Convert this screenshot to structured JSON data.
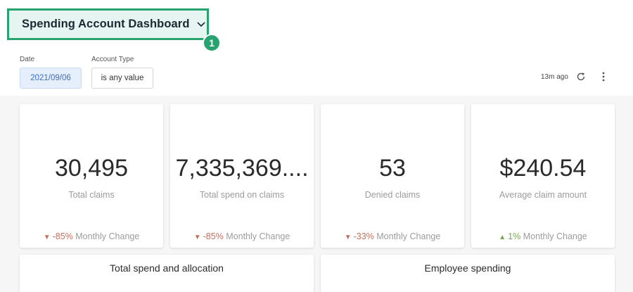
{
  "header": {
    "title": "Spending Account Dashboard",
    "step_badge": "1",
    "accent_color": "#27a36f"
  },
  "filters": [
    {
      "label": "Date",
      "value": "2021/09/06"
    },
    {
      "label": "Account Type",
      "value": "is any value"
    }
  ],
  "toolbar": {
    "updated": "13m ago",
    "icons": [
      "refresh-icon",
      "more-vert-icon"
    ]
  },
  "kpis": [
    {
      "value": "30,495",
      "label": "Total claims",
      "change": "-85%",
      "direction": "down",
      "change_label": "Monthly Change"
    },
    {
      "value": "7,335,369....",
      "label": "Total spend on claims",
      "change": "-85%",
      "direction": "down",
      "change_label": "Monthly Change"
    },
    {
      "value": "53",
      "label": "Denied claims",
      "change": "-33%",
      "direction": "down",
      "change_label": "Monthly Change"
    },
    {
      "value": "$240.54",
      "label": "Average claim amount",
      "change": "1%",
      "direction": "up",
      "change_label": "Monthly Change"
    }
  ],
  "arrows": {
    "down": "▼",
    "up": "▲"
  },
  "panels": [
    {
      "title": "Total spend and allocation"
    },
    {
      "title": "Employee spending"
    }
  ]
}
